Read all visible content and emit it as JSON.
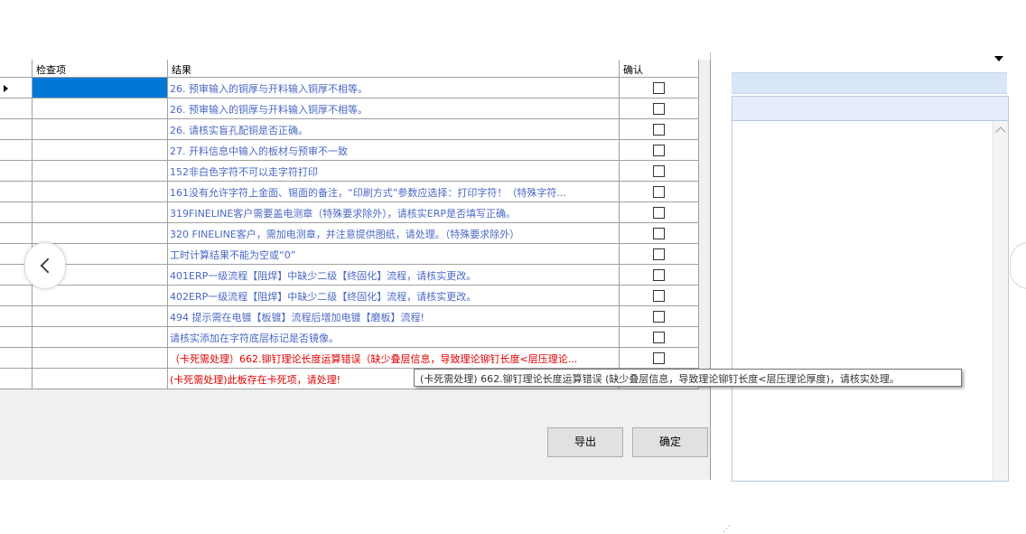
{
  "grid": {
    "columns": [
      "检查项",
      "结果",
      "确认"
    ],
    "rows": [
      {
        "result": "26. 预审输入的铜厚与开料输入铜厚不相等。",
        "color": "blue",
        "selected": true
      },
      {
        "result": "26. 预审输入的铜厚与开料输入铜厚不相等。",
        "color": "blue"
      },
      {
        "result": "26. 请核实盲孔配铜是否正确。",
        "color": "blue"
      },
      {
        "result": "27. 开料信息中输入的板材与预审不一致",
        "color": "blue"
      },
      {
        "result": "152非白色字符不可以走字符打印",
        "color": "blue"
      },
      {
        "result": "161没有允许字符上金面、锡面的备注，“印刷方式”参数应选择：打印字符！（特殊字符...",
        "color": "blue"
      },
      {
        "result": "319FINELINE客户需要盖电测章（特殊要求除外），请核实ERP是否填写正确。",
        "color": "blue"
      },
      {
        "result": "320 FINELINE客户，需加电测章，并注意提供图纸，请处理。（特殊要求除外）",
        "color": "blue"
      },
      {
        "result": "工时计算结果不能为空或“0”",
        "color": "blue"
      },
      {
        "result": "401ERP一级流程【阻焊】中缺少二级【终固化】流程，请核实更改。",
        "color": "blue"
      },
      {
        "result": "402ERP一级流程【阻焊】中缺少二级【终固化】流程，请核实更改。",
        "color": "blue"
      },
      {
        "result": "494 提示需在电镀【板镀】流程后增加电镀【磨板】流程!",
        "color": "blue"
      },
      {
        "result": "请核实添加在字符底层标记是否镜像。",
        "color": "blue"
      },
      {
        "result": "（卡死需处理）662.铆钉理论长度运算错误（缺少叠层信息，导致理论铆钉长度<层压理论...",
        "color": "red"
      },
      {
        "result": "(卡死需处理)此板存在卡死项，请处理!",
        "color": "red"
      }
    ]
  },
  "buttons": {
    "export": "导出",
    "ok": "确定"
  },
  "tooltip": "(卡死需处理) 662.铆钉理论长度运算错误 (缺少叠层信息，导致理论铆钉长度<层压理论厚度)，请核实处理。",
  "colors": {
    "selection": "#0078d7",
    "blue_text": "#4a68c4",
    "red_text": "#e00000"
  },
  "icons": {
    "prev": "chevron-left-icon",
    "dropdown": "caret-down-icon"
  }
}
